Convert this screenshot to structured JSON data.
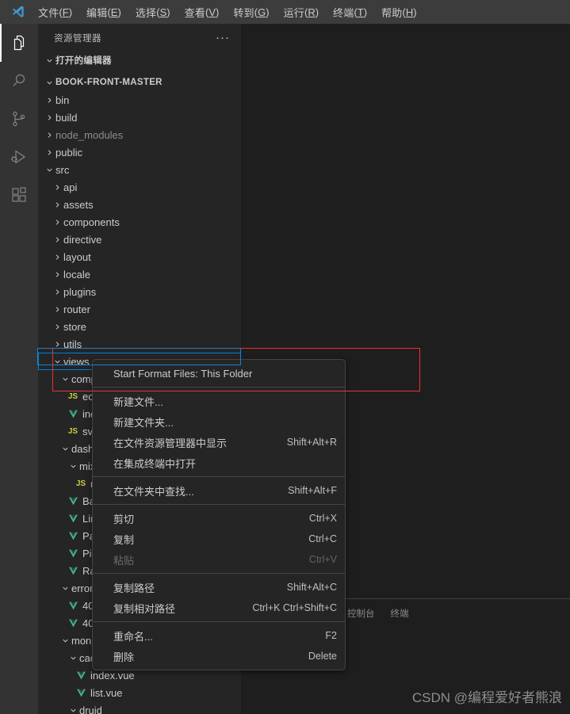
{
  "titlebar": {
    "logo_icon": "vscode-logo-icon",
    "menus": [
      {
        "label": "文件(F)",
        "name": "menu-file"
      },
      {
        "label": "编辑(E)",
        "name": "menu-edit"
      },
      {
        "label": "选择(S)",
        "name": "menu-selection"
      },
      {
        "label": "查看(V)",
        "name": "menu-view"
      },
      {
        "label": "转到(G)",
        "name": "menu-goto"
      },
      {
        "label": "运行(R)",
        "name": "menu-run"
      },
      {
        "label": "终端(T)",
        "name": "menu-terminal"
      },
      {
        "label": "帮助(H)",
        "name": "menu-help"
      }
    ]
  },
  "activitybar": {
    "items": [
      {
        "icon": "files-explorer-icon",
        "active": true
      },
      {
        "icon": "search-icon",
        "active": false
      },
      {
        "icon": "source-control-icon",
        "active": false
      },
      {
        "icon": "run-and-debug-icon",
        "active": false
      },
      {
        "icon": "extensions-icon",
        "active": false
      }
    ]
  },
  "sidebar": {
    "title": "资源管理器",
    "more_actions": "···",
    "open_editors_label": "打开的编辑器",
    "project_label": "BOOK-FRONT-MASTER",
    "tree": [
      {
        "label": "bin",
        "depth": 1,
        "type": "folder",
        "state": "collapsed"
      },
      {
        "label": "build",
        "depth": 1,
        "type": "folder",
        "state": "collapsed"
      },
      {
        "label": "node_modules",
        "depth": 1,
        "type": "folder",
        "state": "collapsed",
        "dim": true
      },
      {
        "label": "public",
        "depth": 1,
        "type": "folder",
        "state": "collapsed"
      },
      {
        "label": "src",
        "depth": 1,
        "type": "folder",
        "state": "expanded"
      },
      {
        "label": "api",
        "depth": 2,
        "type": "folder",
        "state": "collapsed"
      },
      {
        "label": "assets",
        "depth": 2,
        "type": "folder",
        "state": "collapsed"
      },
      {
        "label": "components",
        "depth": 2,
        "type": "folder",
        "state": "collapsed"
      },
      {
        "label": "directive",
        "depth": 2,
        "type": "folder",
        "state": "collapsed"
      },
      {
        "label": "layout",
        "depth": 2,
        "type": "folder",
        "state": "collapsed"
      },
      {
        "label": "locale",
        "depth": 2,
        "type": "folder",
        "state": "collapsed"
      },
      {
        "label": "plugins",
        "depth": 2,
        "type": "folder",
        "state": "collapsed"
      },
      {
        "label": "router",
        "depth": 2,
        "type": "folder",
        "state": "collapsed"
      },
      {
        "label": "store",
        "depth": 2,
        "type": "folder",
        "state": "collapsed"
      },
      {
        "label": "utils",
        "depth": 2,
        "type": "folder",
        "state": "collapsed"
      },
      {
        "label": "views",
        "depth": 2,
        "type": "folder",
        "state": "expanded",
        "selected": true
      },
      {
        "label": "components",
        "depth": 3,
        "type": "folder",
        "state": "expanded"
      },
      {
        "label": "echarts.js",
        "depth": 4,
        "type": "js"
      },
      {
        "label": "index.vue",
        "depth": 4,
        "type": "vue"
      },
      {
        "label": "svg.js",
        "depth": 4,
        "type": "js"
      },
      {
        "label": "dashboard",
        "depth": 3,
        "type": "folder",
        "state": "expanded"
      },
      {
        "label": "mixins",
        "depth": 4,
        "type": "folder",
        "state": "expanded"
      },
      {
        "label": "resize.js",
        "depth": 5,
        "type": "js"
      },
      {
        "label": "BarChart.vue",
        "depth": 4,
        "type": "vue"
      },
      {
        "label": "LineChart.vue",
        "depth": 4,
        "type": "vue"
      },
      {
        "label": "PanelGroup.vue",
        "depth": 4,
        "type": "vue"
      },
      {
        "label": "PieChart.vue",
        "depth": 4,
        "type": "vue"
      },
      {
        "label": "RaddarChart.vue",
        "depth": 4,
        "type": "vue"
      },
      {
        "label": "error",
        "depth": 3,
        "type": "folder",
        "state": "expanded"
      },
      {
        "label": "401.vue",
        "depth": 4,
        "type": "vue"
      },
      {
        "label": "404.vue",
        "depth": 4,
        "type": "vue"
      },
      {
        "label": "monitor",
        "depth": 3,
        "type": "folder",
        "state": "expanded"
      },
      {
        "label": "cache",
        "depth": 4,
        "type": "folder",
        "state": "expanded"
      },
      {
        "label": "index.vue",
        "depth": 5,
        "type": "vue"
      },
      {
        "label": "list.vue",
        "depth": 5,
        "type": "vue"
      },
      {
        "label": "druid",
        "depth": 4,
        "type": "folder",
        "state": "expanded"
      }
    ]
  },
  "context_menu": {
    "groups": [
      [
        {
          "label": "Start Format Files: This Folder",
          "key": "",
          "disabled": false,
          "name": "ctx-start-format-files"
        }
      ],
      [
        {
          "label": "新建文件...",
          "key": "",
          "disabled": false,
          "name": "ctx-new-file"
        },
        {
          "label": "新建文件夹...",
          "key": "",
          "disabled": false,
          "name": "ctx-new-folder"
        },
        {
          "label": "在文件资源管理器中显示",
          "key": "Shift+Alt+R",
          "disabled": false,
          "name": "ctx-reveal-in-explorer"
        },
        {
          "label": "在集成终端中打开",
          "key": "",
          "disabled": false,
          "name": "ctx-open-in-terminal"
        }
      ],
      [
        {
          "label": "在文件夹中查找...",
          "key": "Shift+Alt+F",
          "disabled": false,
          "name": "ctx-find-in-folder"
        }
      ],
      [
        {
          "label": "剪切",
          "key": "Ctrl+X",
          "disabled": false,
          "name": "ctx-cut"
        },
        {
          "label": "复制",
          "key": "Ctrl+C",
          "disabled": false,
          "name": "ctx-copy"
        },
        {
          "label": "粘贴",
          "key": "Ctrl+V",
          "disabled": true,
          "name": "ctx-paste"
        }
      ],
      [
        {
          "label": "复制路径",
          "key": "Shift+Alt+C",
          "disabled": false,
          "name": "ctx-copy-path"
        },
        {
          "label": "复制相对路径",
          "key": "Ctrl+K Ctrl+Shift+C",
          "disabled": false,
          "name": "ctx-copy-relative-path"
        }
      ],
      [
        {
          "label": "重命名...",
          "key": "F2",
          "disabled": false,
          "name": "ctx-rename"
        },
        {
          "label": "删除",
          "key": "Delete",
          "disabled": false,
          "name": "ctx-delete"
        }
      ]
    ]
  },
  "panel": {
    "tabs": [
      {
        "label": "控制台",
        "name": "panel-tab-console"
      },
      {
        "label": "终端",
        "name": "panel-tab-terminal"
      }
    ]
  },
  "annotations": {
    "red_rect_color": "#e8352c",
    "blue_rect_color": "#1d7fd4"
  },
  "watermark": "CSDN @编程爱好者熊浪"
}
